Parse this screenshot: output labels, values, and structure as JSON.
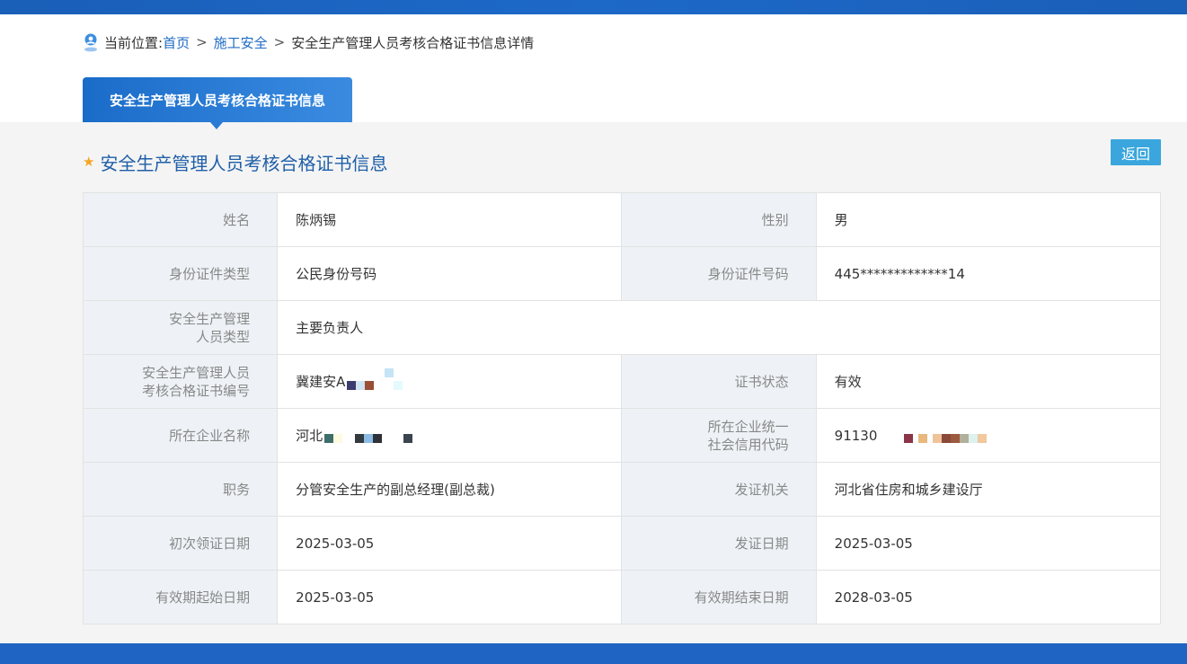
{
  "breadcrumb": {
    "prefix": "当前位置:",
    "home": "首页",
    "category": "施工安全",
    "current": "安全生产管理人员考核合格证书信息详情",
    "separator": ">"
  },
  "tab": {
    "label": "安全生产管理人员考核合格证书信息"
  },
  "section": {
    "title": "安全生产管理人员考核合格证书信息",
    "icon": "star-icon"
  },
  "back_button": "返回",
  "rows": [
    {
      "l1": "姓名",
      "v1": "陈炳锡",
      "l2": "性别",
      "v2": "男"
    },
    {
      "l1": "身份证件类型",
      "v1": "公民身份号码",
      "l2": "身份证件号码",
      "v2": "445*************14"
    },
    {
      "l1": "安全生产管理人员类型",
      "v1": "主要负责人"
    },
    {
      "l1": "安全生产管理人员考核合格证书编号",
      "v1": "冀建安A",
      "l2": "证书状态",
      "v2": "有效"
    },
    {
      "l1": "所在企业名称",
      "v1": "河北",
      "l2": "所在企业统一社会信用代码",
      "v2": "91130"
    },
    {
      "l1": "职务",
      "v1": "分管安全生产的副总经理(副总裁)",
      "l2": "发证机关",
      "v2": "河北省住房和城乡建设厅"
    },
    {
      "l1": "初次领证日期",
      "v1": "2025-03-05",
      "l2": "发证日期",
      "v2": "2025-03-05"
    },
    {
      "l1": "有效期起始日期",
      "v1": "2025-03-05",
      "l2": "有效期结束日期",
      "v2": "2028-03-05"
    }
  ],
  "labels_multiline": {
    "type_a": "安全生产管理",
    "type_b": "人员类型",
    "cert_a": "安全生产管理人员",
    "cert_b": "考核合格证书编号",
    "credit_a": "所在企业统一",
    "credit_b": "社会信用代码"
  },
  "colors": {
    "accent": "#1f6bc4",
    "tab_gradient_start": "#1a6cc9",
    "back_button": "#3aa6dd",
    "star": "#f5a623"
  }
}
